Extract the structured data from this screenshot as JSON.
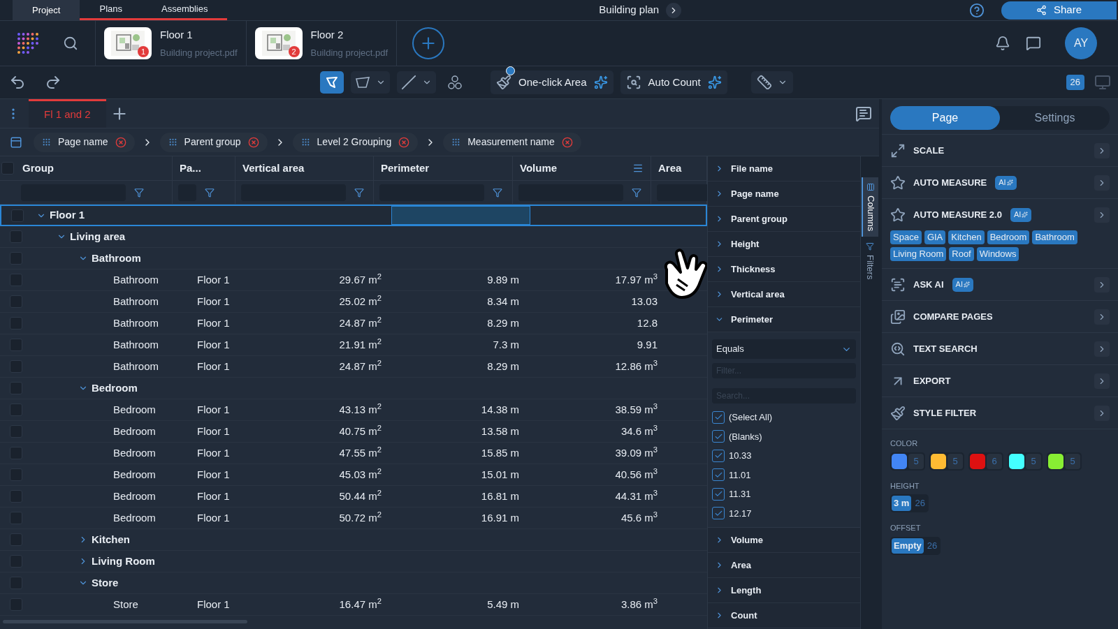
{
  "top_tabs": [
    {
      "label": "Project",
      "selected": true
    },
    {
      "label": "Plans",
      "selected": false
    },
    {
      "label": "Assemblies",
      "selected": false
    }
  ],
  "document_title": "Building plan",
  "share_button": "Share",
  "plans": [
    {
      "name": "Floor 1",
      "file": "Building project.pdf",
      "badge": "1"
    },
    {
      "name": "Floor 2",
      "file": "Building project.pdf",
      "badge": "2"
    }
  ],
  "avatar": "AY",
  "toolbar": {
    "one_click_area": "One-click Area",
    "auto_count": "Auto Count",
    "page_count": "26"
  },
  "view_tabs": [
    {
      "label": "Fl 1 and 2",
      "selected": true
    }
  ],
  "grouping": [
    "Page name",
    "Parent group",
    "Level 2 Grouping",
    "Measurement name"
  ],
  "table": {
    "columns": [
      "Group",
      "Pa...",
      "Vertical area",
      "Perimeter",
      "Volume",
      "Area"
    ],
    "all_checked": false,
    "rows": [
      {
        "name": "Floor 1",
        "checked": false,
        "selected": true,
        "expanded": true,
        "children": [
          {
            "name": "Living area",
            "checked": false,
            "selected": false,
            "expanded": true,
            "children": [
              {
                "name": "Bathroom",
                "checked": false,
                "selected": false,
                "expanded": true,
                "children": [
                  {
                    "name": "Bathroom",
                    "checked": false,
                    "page": "Floor 1",
                    "vertical_area": "29.67 m$^{2}$",
                    "perimeter": "9.89 m",
                    "volume": "17.97 m$^{3}$"
                  },
                  {
                    "name": "Bathroom",
                    "checked": false,
                    "page": "Floor 1",
                    "vertical_area": "25.02 m$^{2}$",
                    "perimeter": "8.34 m",
                    "volume": "13.03"
                  },
                  {
                    "name": "Bathroom",
                    "checked": false,
                    "page": "Floor 1",
                    "vertical_area": "24.87 m$^{2}$",
                    "perimeter": "8.29 m",
                    "volume": "12.8"
                  },
                  {
                    "name": "Bathroom",
                    "checked": false,
                    "page": "Floor 1",
                    "vertical_area": "21.91 m$^{2}$",
                    "perimeter": "7.3 m",
                    "volume": "9.91"
                  },
                  {
                    "name": "Bathroom",
                    "checked": false,
                    "page": "Floor 1",
                    "vertical_area": "24.87 m$^{2}$",
                    "perimeter": "8.29 m",
                    "volume": "12.86 m$^{3}$"
                  }
                ]
              },
              {
                "name": "Bedroom",
                "checked": false,
                "selected": false,
                "expanded": true,
                "children": [
                  {
                    "name": "Bedroom",
                    "checked": false,
                    "page": "Floor 1",
                    "vertical_area": "43.13 m$^{2}$",
                    "perimeter": "14.38 m",
                    "volume": "38.59 m$^{3}$"
                  },
                  {
                    "name": "Bedroom",
                    "checked": false,
                    "page": "Floor 1",
                    "vertical_area": "40.75 m$^{2}$",
                    "perimeter": "13.58 m",
                    "volume": "34.6 m$^{3}$"
                  },
                  {
                    "name": "Bedroom",
                    "checked": false,
                    "page": "Floor 1",
                    "vertical_area": "47.55 m$^{2}$",
                    "perimeter": "15.85 m",
                    "volume": "39.09 m$^{3}$"
                  },
                  {
                    "name": "Bedroom",
                    "checked": false,
                    "page": "Floor 1",
                    "vertical_area": "45.03 m$^{2}$",
                    "perimeter": "15.01 m",
                    "volume": "40.56 m$^{3}$"
                  },
                  {
                    "name": "Bedroom",
                    "checked": false,
                    "page": "Floor 1",
                    "vertical_area": "50.44 m$^{2}$",
                    "perimeter": "16.81 m",
                    "volume": "44.31 m$^{3}$"
                  },
                  {
                    "name": "Bedroom",
                    "checked": false,
                    "page": "Floor 1",
                    "vertical_area": "50.72 m$^{2}$",
                    "perimeter": "16.91 m",
                    "volume": "45.6 m$^{3}$"
                  }
                ]
              },
              {
                "name": "Kitchen",
                "checked": false,
                "selected": false,
                "expanded": false
              },
              {
                "name": "Living Room",
                "checked": false,
                "selected": false,
                "expanded": false
              },
              {
                "name": "Store",
                "checked": false,
                "selected": false,
                "expanded": true,
                "children": [
                  {
                    "name": "Store",
                    "checked": false,
                    "page": "Floor 1",
                    "vertical_area": "16.47 m$^{2}$",
                    "perimeter": "5.49 m",
                    "volume": "3.86 m$^{3}$"
                  }
                ]
              }
            ]
          }
        ]
      }
    ]
  },
  "columns_panel": {
    "fields": [
      {
        "label": "File name",
        "expanded": false
      },
      {
        "label": "Page name",
        "expanded": false
      },
      {
        "label": "Parent group",
        "expanded": false
      },
      {
        "label": "Height",
        "expanded": false
      },
      {
        "label": "Thickness",
        "expanded": false
      },
      {
        "label": "Vertical area",
        "expanded": false
      },
      {
        "label": "Perimeter",
        "expanded": true
      },
      {
        "label": "Volume",
        "expanded": false
      },
      {
        "label": "Area",
        "expanded": false
      },
      {
        "label": "Length",
        "expanded": false
      },
      {
        "label": "Count",
        "expanded": false
      }
    ],
    "filter": {
      "condition": "Equals",
      "filter_placeholder": "Filter...",
      "search_placeholder": "Search...",
      "options": [
        {
          "label": "(Select All)",
          "checked": true
        },
        {
          "label": "(Blanks)",
          "checked": true
        },
        {
          "label": "10.33",
          "checked": true
        },
        {
          "label": "11.01",
          "checked": true
        },
        {
          "label": "11.31",
          "checked": true
        },
        {
          "label": "12.17",
          "checked": true
        }
      ]
    }
  },
  "side_tabs": [
    {
      "label": "Columns",
      "selected": true
    },
    {
      "label": "Filters",
      "selected": false
    }
  ],
  "right_panel": {
    "tabs": [
      {
        "label": "Page",
        "selected": true
      },
      {
        "label": "Settings",
        "selected": false
      }
    ],
    "sections": [
      {
        "title": "SCALE"
      },
      {
        "title": "AUTO MEASURE",
        "badge": "AI"
      },
      {
        "title": "AUTO MEASURE 2.0",
        "badge": "AI",
        "tags": [
          "Space",
          "GIA",
          "Kitchen",
          "Bedroom",
          "Bathroom",
          "Living Room",
          "Roof",
          "Windows"
        ]
      },
      {
        "title": "ASK AI",
        "badge": "AI"
      },
      {
        "title": "COMPARE PAGES"
      },
      {
        "title": "TEXT SEARCH"
      },
      {
        "title": "EXPORT"
      },
      {
        "title": "STYLE FILTER"
      }
    ],
    "style_filter": {
      "color_label": "COLOR",
      "colors": [
        {
          "color": "#4285f4",
          "count": "5"
        },
        {
          "color": "#ffbb33",
          "count": "5"
        },
        {
          "color": "#dd1111",
          "count": "6"
        },
        {
          "color": "#44ffff",
          "count": "5"
        },
        {
          "color": "#88ee33",
          "count": "5"
        }
      ],
      "height_label": "HEIGHT",
      "height": {
        "value": "3 m",
        "count": "26"
      },
      "offset_label": "OFFSET",
      "offset": {
        "value": "Empty",
        "count": "26"
      }
    }
  }
}
